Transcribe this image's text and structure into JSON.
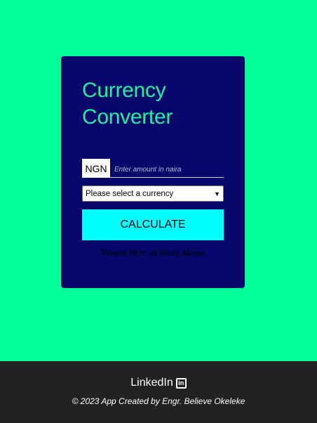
{
  "card": {
    "title": "Currency Converter",
    "currency_code": "NGN",
    "amount_placeholder": "Enter amount in naira",
    "select_value": "Please select a currency",
    "calculate_label": "CALCULATE",
    "status_text": "Please fill in all fields above"
  },
  "footer": {
    "linkedin_label": "LinkedIn",
    "copyright": "© 2023 App Created by Engr. Believe Okeleke"
  },
  "colors": {
    "page_bg": "#00ff99",
    "card_bg": "#07076b",
    "title": "#1ff0a0",
    "button": "#00ffff",
    "footer_bg": "#222222"
  },
  "icons": {
    "select": "chevron-down-icon",
    "linkedin": "linkedin-icon"
  }
}
